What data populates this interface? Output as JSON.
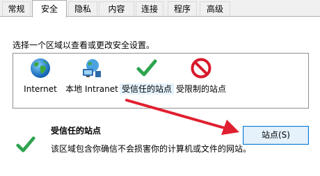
{
  "tabs": [
    {
      "label": "常规"
    },
    {
      "label": "安全"
    },
    {
      "label": "隐私"
    },
    {
      "label": "内容"
    },
    {
      "label": "连接"
    },
    {
      "label": "程序"
    },
    {
      "label": "高级"
    }
  ],
  "instruction": "选择一个区域以查看或更改安全设置。",
  "zones": [
    {
      "label": "Internet",
      "icon": "globe-icon"
    },
    {
      "label": "本地 Intranet",
      "icon": "intranet-icon"
    },
    {
      "label": "受信任的站点",
      "icon": "checkmark-icon"
    },
    {
      "label": "受限制的站点",
      "icon": "prohibited-icon"
    }
  ],
  "selected_zone": {
    "title": "受信任的站点",
    "description": "该区域包含你确信不会损害你的计算机或文件的网站。"
  },
  "sites_button": "站点(S)",
  "colors": {
    "arrow": "#e02030",
    "button_border": "#0078d7",
    "check_green": "#2ea44f",
    "prohibited_red": "#d8192b"
  }
}
